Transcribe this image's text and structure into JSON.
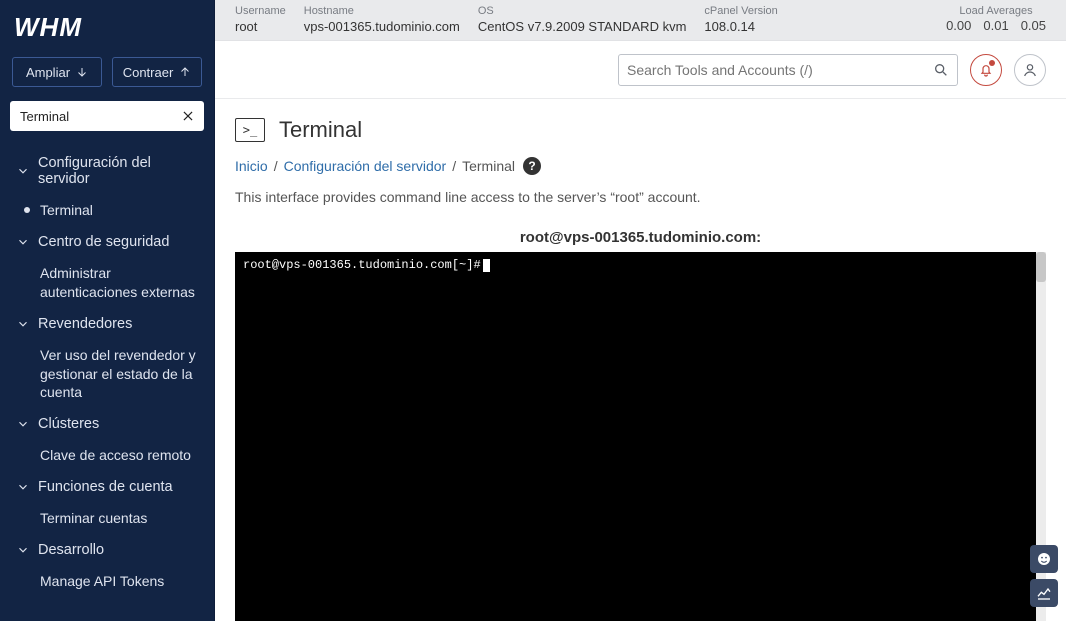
{
  "logo": "WHM",
  "sidebar": {
    "expand_label": "Ampliar",
    "collapse_label": "Contraer",
    "search_value": "Terminal",
    "groups": [
      {
        "label": "Configuración del servidor",
        "items": [
          {
            "label": "Terminal",
            "active": true
          }
        ]
      },
      {
        "label": "Centro de seguridad",
        "items": [
          {
            "label": "Administrar autenticaciones externas"
          }
        ]
      },
      {
        "label": "Revendedores",
        "items": [
          {
            "label": "Ver uso del revendedor y gestionar el estado de la cuenta"
          }
        ]
      },
      {
        "label": "Clústeres",
        "items": [
          {
            "label": "Clave de acceso remoto"
          }
        ]
      },
      {
        "label": "Funciones de cuenta",
        "items": [
          {
            "label": "Terminar cuentas"
          }
        ]
      },
      {
        "label": "Desarrollo",
        "items": [
          {
            "label": "Manage API Tokens"
          }
        ]
      }
    ]
  },
  "infobar": {
    "username_k": "Username",
    "username_v": "root",
    "hostname_k": "Hostname",
    "hostname_v": "vps-001365.tudominio.com",
    "os_k": "OS",
    "os_v": "CentOS v7.9.2009 STANDARD kvm",
    "ver_k": "cPanel Version",
    "ver_v": "108.0.14",
    "load_k": "Load Averages",
    "load_v": [
      "0.00",
      "0.01",
      "0.05"
    ]
  },
  "toolbar": {
    "search_placeholder": "Search Tools and Accounts (/)"
  },
  "page": {
    "title": "Terminal",
    "icon_glyph": ">_",
    "crumb_home": "Inicio",
    "crumb_mid": "Configuración del servidor",
    "crumb_leaf": "Terminal",
    "description": "This interface provides command line access to the server’s “root” account.",
    "term_title": "root@vps-001365.tudominio.com:",
    "term_prompt": "root@vps-001365.tudominio.com[~]#"
  }
}
